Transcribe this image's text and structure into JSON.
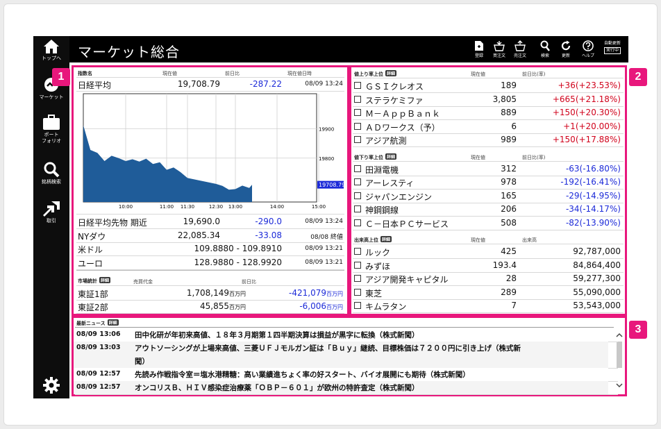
{
  "sidebar": {
    "items": [
      {
        "label_line1": "トップへ",
        "label_line2": "",
        "icon": "home-icon"
      },
      {
        "label_line1": "マーケット",
        "label_line2": "",
        "icon": "market-icon"
      },
      {
        "label_line1": "ポート",
        "label_line2": "フォリオ",
        "icon": "briefcase-icon"
      },
      {
        "label_line1": "銘柄検索",
        "label_line2": "",
        "icon": "search-icon"
      },
      {
        "label_line1": "取引",
        "label_line2": "",
        "icon": "trade-icon"
      }
    ],
    "settings_icon": "gear-icon"
  },
  "header": {
    "title": "マーケット総合",
    "toolbar": [
      {
        "label": "登録",
        "icon": "register-icon"
      },
      {
        "label": "買注文",
        "icon": "buy-order-icon"
      },
      {
        "label": "売注文",
        "icon": "sell-order-icon"
      },
      {
        "label": "検索",
        "icon": "search-icon"
      },
      {
        "label": "更新",
        "icon": "refresh-icon"
      },
      {
        "label": "ヘルプ",
        "icon": "help-icon"
      }
    ],
    "auto_update_label": "自動更新",
    "auto_update_state": "実行中"
  },
  "badges": {
    "one": "1",
    "two": "2",
    "three": "3"
  },
  "index_panel": {
    "headers": {
      "name": "指数名",
      "price": "現在値",
      "change": "前日比",
      "time": "現在値日時"
    },
    "nikkei": {
      "name": "日経平均",
      "price": "19,708.79",
      "change": "-287.22",
      "time": "08/09 13:24"
    },
    "rows": [
      {
        "name": "日経平均先物 期近",
        "price": "19,690.0",
        "change": "-290.0",
        "time": "08/09 13:24"
      },
      {
        "name": "NYダウ",
        "price": "22,085.34",
        "change": "-33.08",
        "time": "08/08 終値"
      },
      {
        "name": "米ドル",
        "price": "109.8880 - 109.8910",
        "change": "",
        "time": "08/09 13:21"
      },
      {
        "name": "ユーロ",
        "price": "128.9880 - 128.9920",
        "change": "",
        "time": "08/09 13:21"
      }
    ],
    "market_stats": {
      "title": "市場統計",
      "detail": "詳細",
      "col_value": "売買代金",
      "col_change": "前日比",
      "rows": [
        {
          "name": "東証1部",
          "value": "1,708,149",
          "value_unit": "百万円",
          "change": "-421,079",
          "change_unit": "百万円"
        },
        {
          "name": "東証2部",
          "value": "45,855",
          "value_unit": "百万円",
          "change": "-6,006",
          "change_unit": "百万円"
        }
      ]
    }
  },
  "chart_data": {
    "type": "area",
    "title": "",
    "xlabel": "",
    "ylabel": "",
    "x_ticks": [
      "10:00",
      "11:00",
      "11:30",
      "12:30",
      "13:00",
      "14:00",
      "15:00"
    ],
    "y_ticks": [
      "19900",
      "19800"
    ],
    "ylim": [
      19650,
      20020
    ],
    "current_label": "19708.79",
    "series": [
      {
        "x": [
          "9:00",
          "9:10",
          "9:20",
          "9:30",
          "9:40",
          "9:50",
          "10:00",
          "10:10",
          "10:20",
          "10:30",
          "10:40",
          "10:50",
          "11:00",
          "11:10",
          "11:20",
          "11:30",
          "12:30",
          "12:40",
          "12:50",
          "13:00",
          "13:10",
          "13:20",
          "13:24"
        ],
        "values": [
          19912,
          19828,
          19818,
          19790,
          19808,
          19800,
          19790,
          19796,
          19788,
          19798,
          19780,
          19786,
          19760,
          19768,
          19752,
          19732,
          19712,
          19705,
          19692,
          19694,
          19706,
          19698,
          19709
        ]
      }
    ],
    "grid": true,
    "color": "#1f5c99"
  },
  "rankings": {
    "gainers": {
      "title": "値上り率上位",
      "detail": "詳細",
      "col_price": "現在値",
      "col_change": "前日比(率)",
      "rows": [
        {
          "name": "ＧＳＩクレオス",
          "price": "189",
          "change": "+36(+23.53%)"
        },
        {
          "name": "ステラケミファ",
          "price": "3,805",
          "change": "+665(+21.18%)"
        },
        {
          "name": "Ｍ－ＡｐｐＢａｎｋ",
          "price": "889",
          "change": "+150(+20.30%)"
        },
        {
          "name": "ＡＤワークス（予）",
          "price": "6",
          "change": "+1(+20.00%)"
        },
        {
          "name": "アジア航測",
          "price": "989",
          "change": "+150(+17.88%)"
        }
      ]
    },
    "losers": {
      "title": "値下り率上位",
      "detail": "詳細",
      "col_price": "現在値",
      "col_change": "前日比(率)",
      "rows": [
        {
          "name": "田淵電機",
          "price": "312",
          "change": "-63(-16.80%)"
        },
        {
          "name": "アーレスティ",
          "price": "978",
          "change": "-192(-16.41%)"
        },
        {
          "name": "ジャパンエンジン",
          "price": "165",
          "change": "-29(-14.95%)"
        },
        {
          "name": "神鋼鋼線",
          "price": "206",
          "change": "-34(-14.17%)"
        },
        {
          "name": "Ｃ－日本ＰＣサービス",
          "price": "508",
          "change": "-82(-13.90%)"
        }
      ]
    },
    "volume": {
      "title": "出来高上位",
      "detail": "詳細",
      "col_price": "現在値",
      "col_volume": "出来高",
      "rows": [
        {
          "name": "ルック",
          "price": "425",
          "volume": "92,787,000"
        },
        {
          "name": "みずほ",
          "price": "193.4",
          "volume": "84,864,400"
        },
        {
          "name": "アジア開発キャピタル",
          "price": "28",
          "volume": "59,277,300"
        },
        {
          "name": "東芝",
          "price": "289",
          "volume": "55,090,000"
        },
        {
          "name": "キムラタン",
          "price": "7",
          "volume": "53,543,000"
        }
      ]
    }
  },
  "news": {
    "title": "最新ニュース",
    "detail": "詳細",
    "items": [
      {
        "time": "08/09 13:06",
        "line1": "田中化研が年初来高値、１８年３月期第１四半期決算は損益が黒字に転換（株式新聞）",
        "line2": ""
      },
      {
        "time": "08/09 13:03",
        "line1": "アウトソーシングが上場来高値、三菱ＵＦＪモルガン証は「Ｂｕｙ」継続、目標株価は７２００円に引き上げ（株式新",
        "line2": "聞）"
      },
      {
        "time": "08/09 12:57",
        "line1": "先読み作戦指令室＝塩水港精糖：高い業績進ちょく率の好スタート、バイオ展開にも期待（株式新聞）",
        "line2": ""
      },
      {
        "time": "08/09 12:57",
        "line1": "オンコリスＢ、ＨＩＶ感染症治療薬「ＯＢＰ－６０１」が欧州の特許査定（株式新聞）",
        "line2": ""
      }
    ]
  }
}
